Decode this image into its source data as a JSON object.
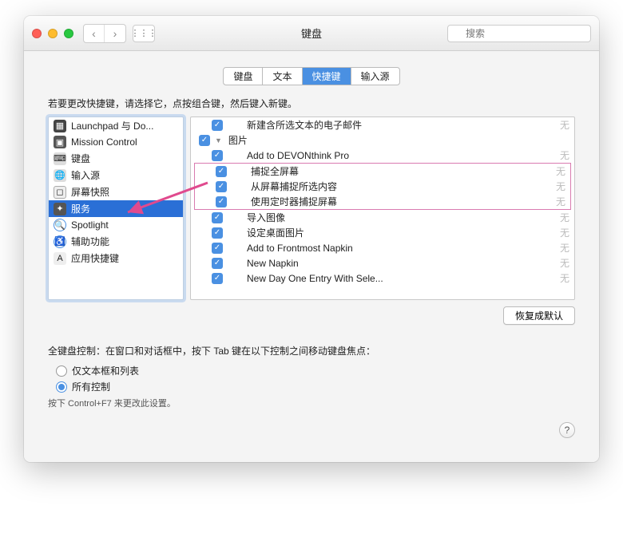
{
  "window": {
    "title": "键盘",
    "search_placeholder": "搜索"
  },
  "tabs": [
    "键盘",
    "文本",
    "快捷键",
    "输入源"
  ],
  "selected_tab_index": 2,
  "instruction": "若要更改快捷键，请选择它，点按组合键，然后键入新键。",
  "sidebar": {
    "items": [
      {
        "icon": "launchpad",
        "label": "Launchpad 与 Do..."
      },
      {
        "icon": "mission",
        "label": "Mission Control"
      },
      {
        "icon": "keyboard",
        "label": "键盘"
      },
      {
        "icon": "input",
        "label": "输入源"
      },
      {
        "icon": "screenshot",
        "label": "屏幕快照"
      },
      {
        "icon": "services",
        "label": "服务"
      },
      {
        "icon": "spotlight",
        "label": "Spotlight"
      },
      {
        "icon": "accessibility",
        "label": "辅助功能"
      },
      {
        "icon": "appshort",
        "label": "应用快捷键"
      }
    ],
    "selected_index": 5
  },
  "rightpane": {
    "top_item": {
      "label": "新建含所选文本的电子邮件",
      "shortcut": "无"
    },
    "group_label": "图片",
    "items_above": [
      {
        "label": "Add to DEVONthink Pro",
        "shortcut": "无"
      }
    ],
    "highlight": [
      {
        "label": "捕捉全屏幕",
        "shortcut": "无"
      },
      {
        "label": "从屏幕捕捉所选内容",
        "shortcut": "无"
      },
      {
        "label": "使用定时器捕捉屏幕",
        "shortcut": "无"
      }
    ],
    "items_below": [
      {
        "label": "导入图像",
        "shortcut": "无"
      },
      {
        "label": "设定桌面图片",
        "shortcut": "无"
      },
      {
        "label": "Add to Frontmost Napkin",
        "shortcut": "无"
      },
      {
        "label": "New Napkin",
        "shortcut": "无"
      },
      {
        "label": "New Day One Entry With Sele...",
        "shortcut": "无"
      }
    ]
  },
  "restore_button": "恢复成默认",
  "keyboard_control": {
    "heading": "全键盘控制：在窗口和对话框中，按下 Tab 键在以下控制之间移动键盘焦点：",
    "options": [
      "仅文本框和列表",
      "所有控制"
    ],
    "selected_index": 1,
    "note": "按下 Control+F7 来更改此设置。"
  }
}
